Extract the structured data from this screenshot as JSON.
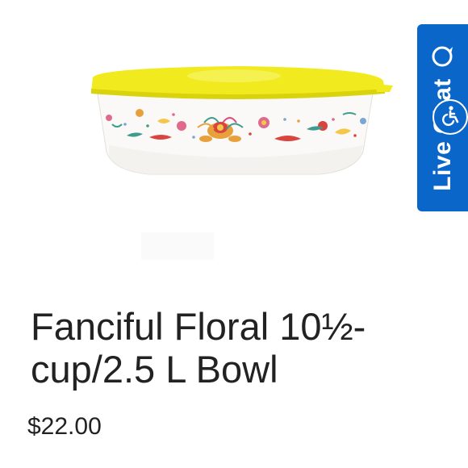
{
  "product": {
    "title": "Fanciful Floral 10½-cup/2.5 L Bowl",
    "price": "$22.00",
    "image_icon": "floral-bowl-image"
  },
  "widgets": {
    "live_chat_label": "Live Chat",
    "chat_icon": "chat-bubble-icon",
    "accessibility_icon": "wheelchair-accessibility-icon"
  },
  "colors": {
    "lid": "#f0ea1e",
    "chat_bg": "#0a66c8",
    "text": "#222222"
  }
}
